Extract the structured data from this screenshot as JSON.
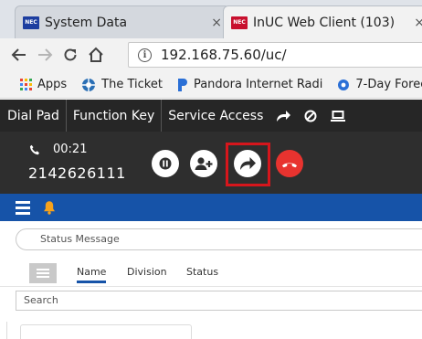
{
  "browser": {
    "tabs": [
      {
        "title": "System Data",
        "close": "×",
        "icon_text": "NEC"
      },
      {
        "title": "InUC Web Client (103)",
        "close": "×",
        "icon_text": "NEC"
      }
    ],
    "url": "192.168.75.60/uc/",
    "bookmarks": [
      {
        "label": "Apps",
        "icon": "apps-grid-icon"
      },
      {
        "label": "The Ticket",
        "icon": "ticket-icon"
      },
      {
        "label": "Pandora Internet Radi",
        "icon": "pandora-icon"
      },
      {
        "label": "7-Day Forec",
        "icon": "forecast-icon"
      }
    ]
  },
  "app": {
    "nav": [
      {
        "label": "Dial Pad"
      },
      {
        "label": "Function Key"
      },
      {
        "label": "Service Access"
      }
    ],
    "nav_icons": [
      "forward-icon",
      "block-icon",
      "computer-icon"
    ],
    "call": {
      "timer": "00:21",
      "number": "2142626111",
      "buttons": [
        "hold-button",
        "add-call-button",
        "transfer-button",
        "hangup-button"
      ]
    },
    "status_placeholder": "Status Message",
    "contact_tabs": [
      {
        "label": "Name",
        "active": true
      },
      {
        "label": "Division",
        "active": false
      },
      {
        "label": "Status",
        "active": false
      }
    ],
    "search_placeholder": "Search"
  },
  "colors": {
    "app_nav_bg": "#262626",
    "call_bar_bg": "#2e2e2e",
    "blue_bar": "#1653a8",
    "hangup_red": "#e8332f",
    "highlight_red": "#d6161c",
    "bell_orange": "#f7a21b"
  }
}
